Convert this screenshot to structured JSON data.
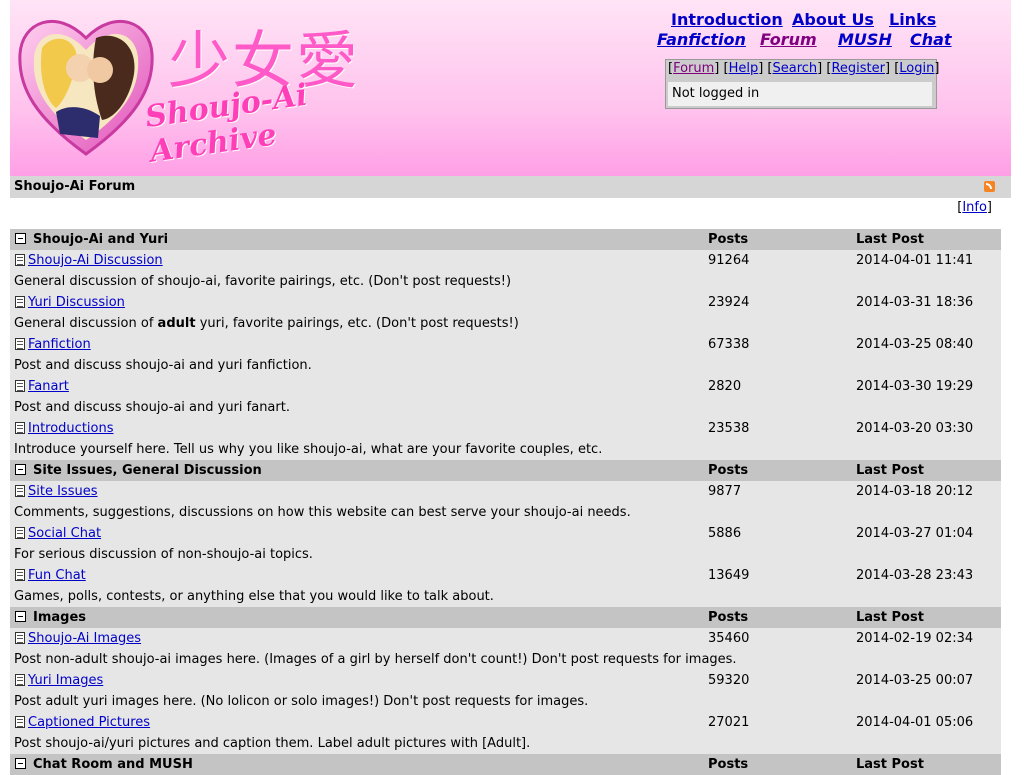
{
  "header": {
    "logo_kanji": "少女愛",
    "logo_script": "Shoujo-Ai Archive",
    "nav_row1": [
      "Introduction",
      "About Us",
      "Links"
    ],
    "nav_row2": [
      "Fanfiction",
      "Forum",
      "MUSH",
      "Chat"
    ],
    "user_links": [
      "Forum",
      "Help",
      "Search",
      "Register",
      "Login"
    ],
    "status": "Not logged in"
  },
  "titlebar": {
    "title": "Shoujo-Ai Forum"
  },
  "info_label": "Info",
  "columns": {
    "posts": "Posts",
    "last_post": "Last Post"
  },
  "categories": [
    {
      "name": "Shoujo-Ai and Yuri",
      "forums": [
        {
          "name": "Shoujo-Ai Discussion",
          "posts": "91264",
          "last": "2014-04-01 11:41",
          "desc_before": "General discussion of shoujo-ai, favorite pairings, etc. (Don't post requests!)",
          "desc_bold": "",
          "desc_after": ""
        },
        {
          "name": "Yuri Discussion",
          "posts": "23924",
          "last": "2014-03-31 18:36",
          "desc_before": "General discussion of ",
          "desc_bold": "adult",
          "desc_after": " yuri, favorite pairings, etc. (Don't post requests!)"
        },
        {
          "name": "Fanfiction",
          "posts": "67338",
          "last": "2014-03-25 08:40",
          "desc_before": "Post and discuss shoujo-ai and yuri fanfiction.",
          "desc_bold": "",
          "desc_after": ""
        },
        {
          "name": "Fanart",
          "posts": "2820",
          "last": "2014-03-30 19:29",
          "desc_before": "Post and discuss shoujo-ai and yuri fanart.",
          "desc_bold": "",
          "desc_after": ""
        },
        {
          "name": "Introductions",
          "posts": "23538",
          "last": "2014-03-20 03:30",
          "desc_before": "Introduce yourself here. Tell us why you like shoujo-ai, what are your favorite couples, etc.",
          "desc_bold": "",
          "desc_after": ""
        }
      ]
    },
    {
      "name": "Site Issues, General Discussion",
      "forums": [
        {
          "name": "Site Issues",
          "posts": "9877",
          "last": "2014-03-18 20:12",
          "desc_before": "Comments, suggestions, discussions on how this website can best serve your shoujo-ai needs.",
          "desc_bold": "",
          "desc_after": ""
        },
        {
          "name": "Social Chat",
          "posts": "5886",
          "last": "2014-03-27 01:04",
          "desc_before": "For serious discussion of non-shoujo-ai topics.",
          "desc_bold": "",
          "desc_after": ""
        },
        {
          "name": "Fun Chat",
          "posts": "13649",
          "last": "2014-03-28 23:43",
          "desc_before": "Games, polls, contests, or anything else that you would like to talk about.",
          "desc_bold": "",
          "desc_after": ""
        }
      ]
    },
    {
      "name": "Images",
      "forums": [
        {
          "name": "Shoujo-Ai Images",
          "posts": "35460",
          "last": "2014-02-19 02:34",
          "desc_before": "Post non-adult shoujo-ai images here. (Images of a girl by herself don't count!) Don't post requests for images.",
          "desc_bold": "",
          "desc_after": ""
        },
        {
          "name": "Yuri Images",
          "posts": "59320",
          "last": "2014-03-25 00:07",
          "desc_before": "Post adult yuri images here. (No lolicon or solo images!) Don't post requests for images.",
          "desc_bold": "",
          "desc_after": ""
        },
        {
          "name": "Captioned Pictures",
          "posts": "27021",
          "last": "2014-04-01 05:06",
          "desc_before": "Post shoujo-ai/yuri pictures and caption them. Label adult pictures with [Adult].",
          "desc_bold": "",
          "desc_after": ""
        }
      ]
    },
    {
      "name": "Chat Room and MUSH",
      "forums": []
    }
  ],
  "icons": {
    "collapse": "collapse-icon",
    "forum": "forum-doc-icon",
    "rss": "rss-icon"
  },
  "colors": {
    "link": "#0000c8",
    "visited": "#800080",
    "header_pink": "#ff9fe6",
    "category_bg": "#c4c4c4",
    "row_bg": "#e6e6e6"
  }
}
